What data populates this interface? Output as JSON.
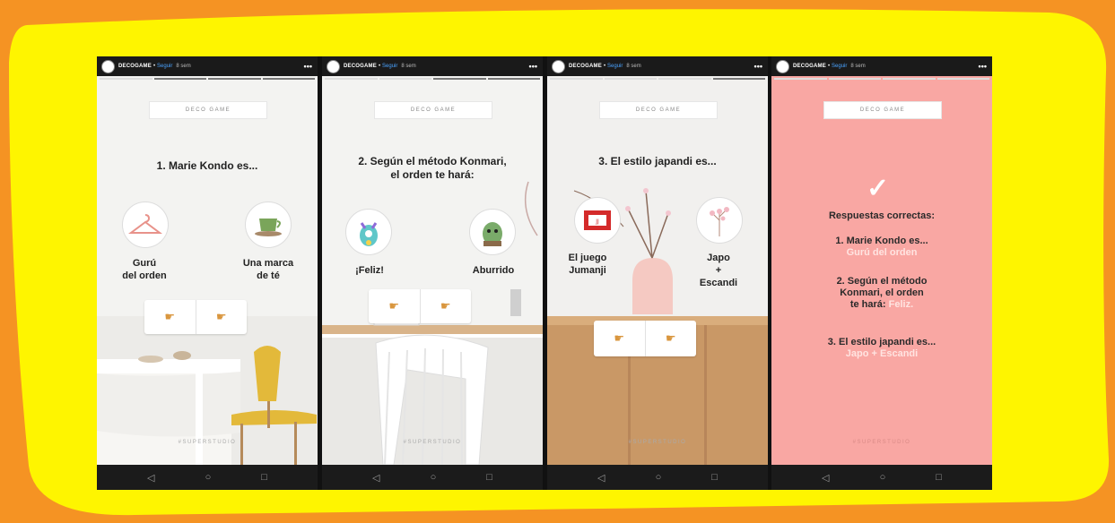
{
  "colors": {
    "background": "#f59323",
    "frame": "#fef500",
    "answer_panel": "#f9a7a3",
    "highlight": "#ffe4e1",
    "follow": "#4aa3ff"
  },
  "stories": [
    {
      "account": "DECOGAME",
      "follow": "Seguir",
      "time": "8 sem",
      "more": "•••",
      "badge": "DECO GAME",
      "question": "1. Marie Kondo es...",
      "options": [
        {
          "label": "Gurú\ndel orden",
          "icon": "hanger-icon"
        },
        {
          "label": "Una marca\nde té",
          "icon": "teacup-icon"
        }
      ],
      "poll_icons": [
        "pointing-hand-icon",
        "pointing-hand-icon"
      ],
      "hashtag": "#SUPERSTUDIO"
    },
    {
      "account": "DECOGAME",
      "follow": "Seguir",
      "time": "8 sem",
      "more": "•••",
      "badge": "DECO GAME",
      "question": "2. Según el método Konmari,\nel orden te hará:",
      "options": [
        {
          "label": "¡Feliz!",
          "icon": "happy-creature-icon"
        },
        {
          "label": "Aburrido",
          "icon": "bored-creature-icon"
        }
      ],
      "poll_icons": [
        "pointing-hand-icon",
        "pointing-hand-icon"
      ],
      "hashtag": "#SUPERSTUDIO"
    },
    {
      "account": "DECOGAME",
      "follow": "Seguir",
      "time": "8 sem",
      "more": "•••",
      "badge": "DECO GAME",
      "question": "3. El estilo japandi es...",
      "options": [
        {
          "label": "El juego\nJumanji",
          "icon": "game-box-icon"
        },
        {
          "label": "Japo\n+\nEscandi",
          "icon": "cherry-blossom-icon"
        }
      ],
      "poll_icons": [
        "pointing-hand-icon",
        "pointing-hand-icon"
      ],
      "hashtag": "#SUPERSTUDIO"
    },
    {
      "account": "DECOGAME",
      "follow": "Seguir",
      "time": "8 sem",
      "more": "•••",
      "badge": "DECO GAME",
      "check": "✓",
      "title": "Respuestas correctas:",
      "answers": [
        {
          "q": "1. Marie Kondo es...",
          "a": "Gurú del orden"
        },
        {
          "q1": "2. Según el método",
          "q2": "Konmari, el orden",
          "q3": "te hará:",
          "a": "Feliz."
        },
        {
          "q": "3. El estilo japandi es...",
          "a": "Japo + Escandi"
        }
      ],
      "hashtag": "#SUPERSTUDIO"
    }
  ],
  "navbar": {
    "back": "◁",
    "home": "○",
    "recent": "□"
  }
}
